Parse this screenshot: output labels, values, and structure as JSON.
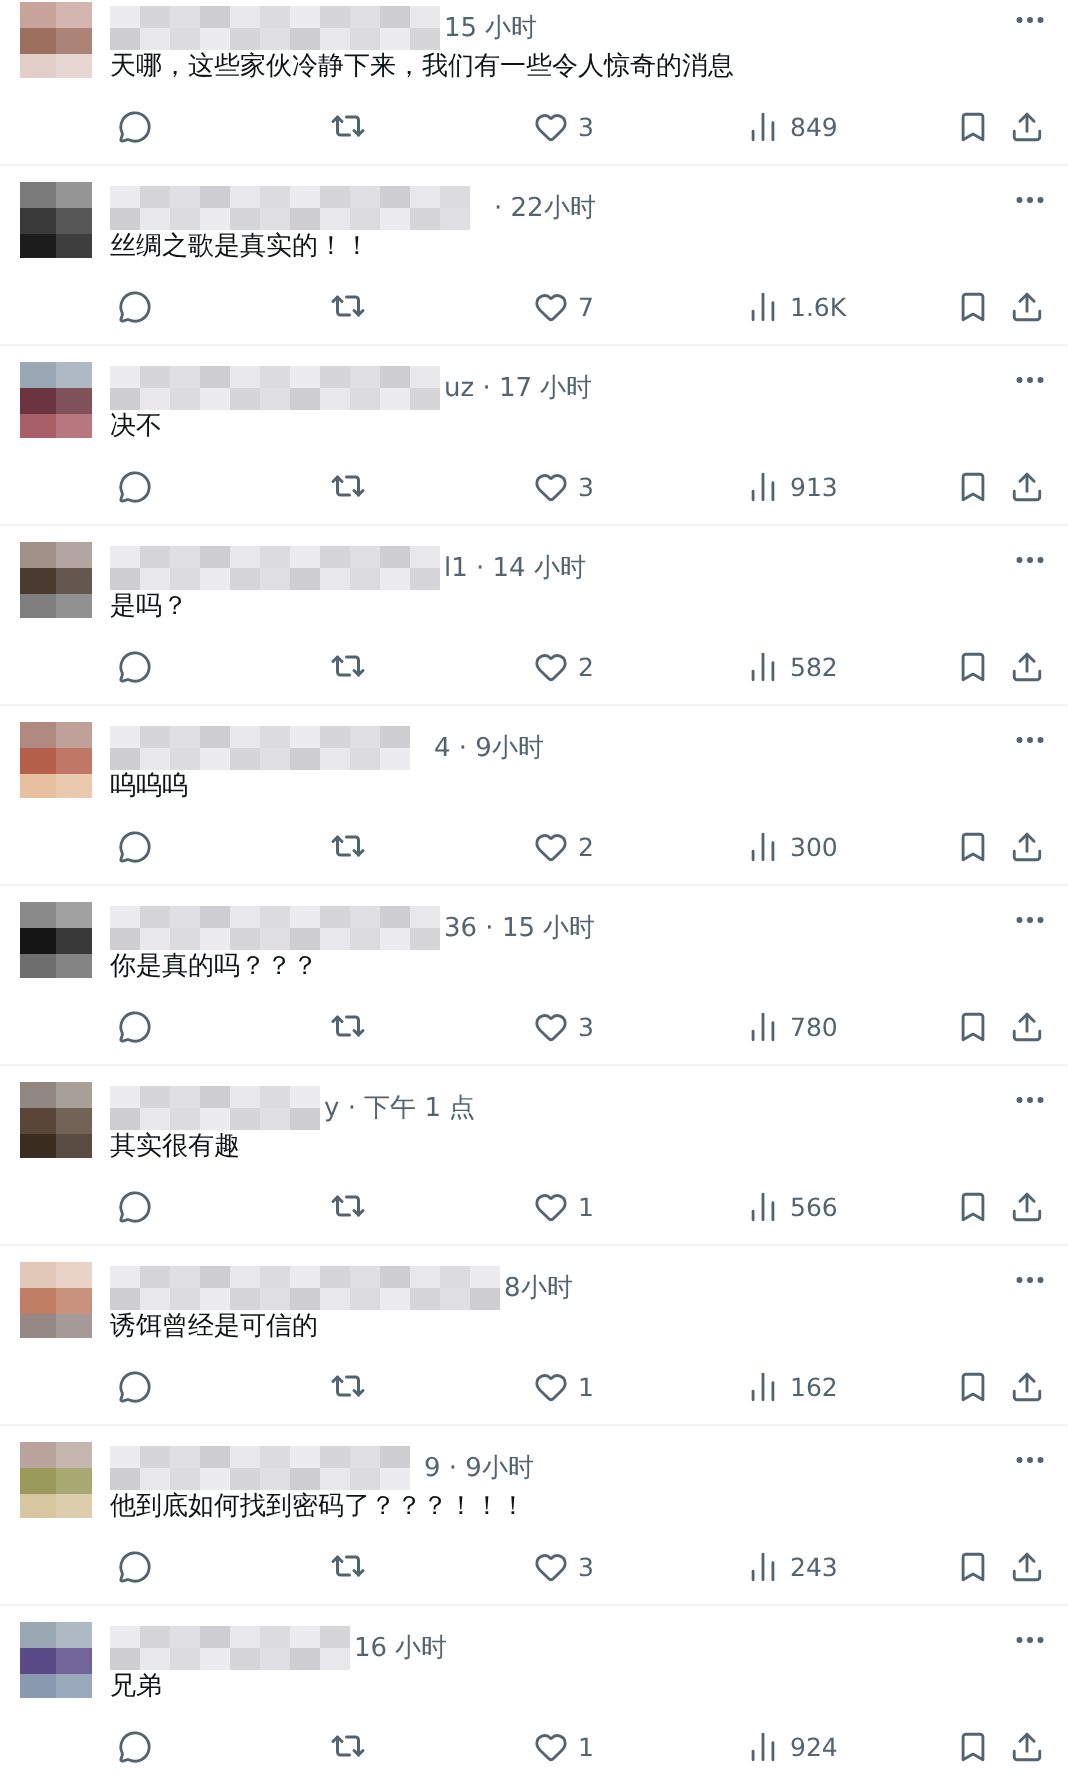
{
  "replies": [
    {
      "meta": "15 小时",
      "text": "天哪，这些家伙冷静下来，我们有一些令人惊奇的消息",
      "likes": "3",
      "views": "849"
    },
    {
      "meta": "· 22小时",
      "text": "丝绸之歌是真实的！！",
      "likes": "7",
      "views": "1.6K"
    },
    {
      "meta": "uz · 17 小时",
      "text": "决不",
      "likes": "3",
      "views": "913"
    },
    {
      "meta": "l1 · 14 小时",
      "text": "是吗？",
      "likes": "2",
      "views": "582"
    },
    {
      "meta": "4 · 9小时",
      "text": "呜呜呜",
      "likes": "2",
      "views": "300"
    },
    {
      "meta": "36 · 15 小时",
      "text": "你是真的吗？？？",
      "likes": "3",
      "views": "780"
    },
    {
      "meta": "y · 下午 1 点",
      "text": "其实很有趣",
      "likes": "1",
      "views": "566"
    },
    {
      "meta": "8小时",
      "text": "诱饵曾经是可信的",
      "likes": "1",
      "views": "162"
    },
    {
      "meta": "9 · 9小时",
      "text": "他到底如何找到密码了？？？！！！",
      "likes": "3",
      "views": "243"
    },
    {
      "meta": "16 小时",
      "text": "兄弟",
      "likes": "1",
      "views": "924"
    }
  ]
}
